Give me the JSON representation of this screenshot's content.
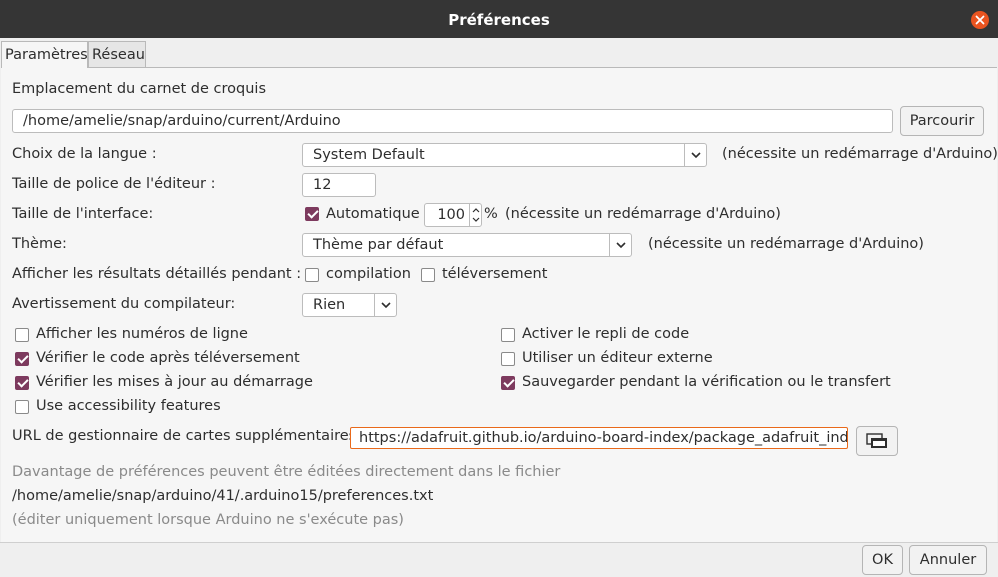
{
  "window": {
    "title": "Préférences"
  },
  "tabs": [
    {
      "label": "Paramètres",
      "active": true
    },
    {
      "label": "Réseau",
      "active": false
    }
  ],
  "sketchbook": {
    "label": "Emplacement du carnet de croquis",
    "path": "/home/amelie/snap/arduino/current/Arduino",
    "browse_label": "Parcourir"
  },
  "language": {
    "label": "Choix de la langue :",
    "value": "System Default",
    "note": "(nécessite un redémarrage d'Arduino)"
  },
  "font_size": {
    "label": "Taille de police de l'éditeur :",
    "value": "12"
  },
  "interface_scale": {
    "label": "Taille de l'interface:",
    "auto_label": "Automatique",
    "auto_checked": true,
    "value": "100",
    "unit": "%",
    "note": "(nécessite un redémarrage d'Arduino)"
  },
  "theme": {
    "label": "Thème:",
    "value": "Thème par défaut",
    "note": "(nécessite un redémarrage d'Arduino)"
  },
  "verbose": {
    "label": "Afficher les résultats détaillés pendant :",
    "compile_label": "compilation",
    "compile_checked": false,
    "upload_label": "téléversement",
    "upload_checked": false
  },
  "compiler_warnings": {
    "label": "Avertissement du compilateur:",
    "value": "Rien"
  },
  "options_left": [
    {
      "label": "Afficher les numéros de ligne",
      "checked": false
    },
    {
      "label": "Vérifier le code après téléversement",
      "checked": true
    },
    {
      "label": "Vérifier les mises à jour au démarrage",
      "checked": true
    },
    {
      "label": "Use accessibility features",
      "checked": false
    }
  ],
  "options_right": [
    {
      "label": "Activer le repli de code",
      "checked": false
    },
    {
      "label": "Utiliser un éditeur externe",
      "checked": false
    },
    {
      "label": "Sauvegarder pendant la vérification ou le transfert",
      "checked": true
    }
  ],
  "board_urls": {
    "label": "URL de gestionnaire de cartes supplémentaires",
    "value": "https://adafruit.github.io/arduino-board-index/package_adafruit_ind"
  },
  "footer_info": {
    "line1": "Davantage de préférences peuvent être éditées directement dans le fichier",
    "line2": "/home/amelie/snap/arduino/41/.arduino15/preferences.txt",
    "line3": "(éditer uniquement lorsque Arduino ne s'exécute pas)"
  },
  "buttons": {
    "ok": "OK",
    "cancel": "Annuler"
  },
  "colors": {
    "accent": "#7d3a5e",
    "close": "#e95420",
    "titlebar": "#353535",
    "focus": "#e9691a"
  }
}
